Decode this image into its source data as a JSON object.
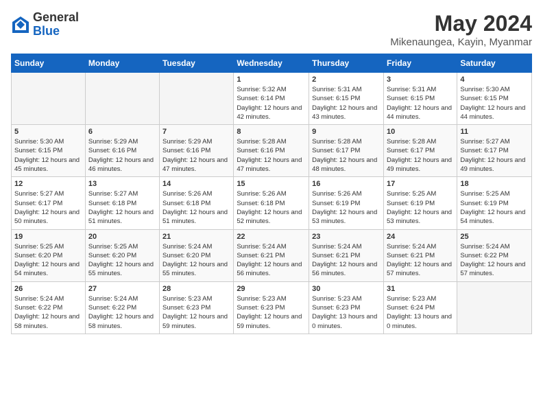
{
  "logo": {
    "general": "General",
    "blue": "Blue"
  },
  "title": "May 2024",
  "location": "Mikenaungea, Kayin, Myanmar",
  "days_of_week": [
    "Sunday",
    "Monday",
    "Tuesday",
    "Wednesday",
    "Thursday",
    "Friday",
    "Saturday"
  ],
  "weeks": [
    [
      {
        "day": "",
        "info": ""
      },
      {
        "day": "",
        "info": ""
      },
      {
        "day": "",
        "info": ""
      },
      {
        "day": "1",
        "info": "Sunrise: 5:32 AM\nSunset: 6:14 PM\nDaylight: 12 hours\nand 42 minutes."
      },
      {
        "day": "2",
        "info": "Sunrise: 5:31 AM\nSunset: 6:15 PM\nDaylight: 12 hours\nand 43 minutes."
      },
      {
        "day": "3",
        "info": "Sunrise: 5:31 AM\nSunset: 6:15 PM\nDaylight: 12 hours\nand 44 minutes."
      },
      {
        "day": "4",
        "info": "Sunrise: 5:30 AM\nSunset: 6:15 PM\nDaylight: 12 hours\nand 44 minutes."
      }
    ],
    [
      {
        "day": "5",
        "info": "Sunrise: 5:30 AM\nSunset: 6:15 PM\nDaylight: 12 hours\nand 45 minutes."
      },
      {
        "day": "6",
        "info": "Sunrise: 5:29 AM\nSunset: 6:16 PM\nDaylight: 12 hours\nand 46 minutes."
      },
      {
        "day": "7",
        "info": "Sunrise: 5:29 AM\nSunset: 6:16 PM\nDaylight: 12 hours\nand 47 minutes."
      },
      {
        "day": "8",
        "info": "Sunrise: 5:28 AM\nSunset: 6:16 PM\nDaylight: 12 hours\nand 47 minutes."
      },
      {
        "day": "9",
        "info": "Sunrise: 5:28 AM\nSunset: 6:17 PM\nDaylight: 12 hours\nand 48 minutes."
      },
      {
        "day": "10",
        "info": "Sunrise: 5:28 AM\nSunset: 6:17 PM\nDaylight: 12 hours\nand 49 minutes."
      },
      {
        "day": "11",
        "info": "Sunrise: 5:27 AM\nSunset: 6:17 PM\nDaylight: 12 hours\nand 49 minutes."
      }
    ],
    [
      {
        "day": "12",
        "info": "Sunrise: 5:27 AM\nSunset: 6:17 PM\nDaylight: 12 hours\nand 50 minutes."
      },
      {
        "day": "13",
        "info": "Sunrise: 5:27 AM\nSunset: 6:18 PM\nDaylight: 12 hours\nand 51 minutes."
      },
      {
        "day": "14",
        "info": "Sunrise: 5:26 AM\nSunset: 6:18 PM\nDaylight: 12 hours\nand 51 minutes."
      },
      {
        "day": "15",
        "info": "Sunrise: 5:26 AM\nSunset: 6:18 PM\nDaylight: 12 hours\nand 52 minutes."
      },
      {
        "day": "16",
        "info": "Sunrise: 5:26 AM\nSunset: 6:19 PM\nDaylight: 12 hours\nand 53 minutes."
      },
      {
        "day": "17",
        "info": "Sunrise: 5:25 AM\nSunset: 6:19 PM\nDaylight: 12 hours\nand 53 minutes."
      },
      {
        "day": "18",
        "info": "Sunrise: 5:25 AM\nSunset: 6:19 PM\nDaylight: 12 hours\nand 54 minutes."
      }
    ],
    [
      {
        "day": "19",
        "info": "Sunrise: 5:25 AM\nSunset: 6:20 PM\nDaylight: 12 hours\nand 54 minutes."
      },
      {
        "day": "20",
        "info": "Sunrise: 5:25 AM\nSunset: 6:20 PM\nDaylight: 12 hours\nand 55 minutes."
      },
      {
        "day": "21",
        "info": "Sunrise: 5:24 AM\nSunset: 6:20 PM\nDaylight: 12 hours\nand 55 minutes."
      },
      {
        "day": "22",
        "info": "Sunrise: 5:24 AM\nSunset: 6:21 PM\nDaylight: 12 hours\nand 56 minutes."
      },
      {
        "day": "23",
        "info": "Sunrise: 5:24 AM\nSunset: 6:21 PM\nDaylight: 12 hours\nand 56 minutes."
      },
      {
        "day": "24",
        "info": "Sunrise: 5:24 AM\nSunset: 6:21 PM\nDaylight: 12 hours\nand 57 minutes."
      },
      {
        "day": "25",
        "info": "Sunrise: 5:24 AM\nSunset: 6:22 PM\nDaylight: 12 hours\nand 57 minutes."
      }
    ],
    [
      {
        "day": "26",
        "info": "Sunrise: 5:24 AM\nSunset: 6:22 PM\nDaylight: 12 hours\nand 58 minutes."
      },
      {
        "day": "27",
        "info": "Sunrise: 5:24 AM\nSunset: 6:22 PM\nDaylight: 12 hours\nand 58 minutes."
      },
      {
        "day": "28",
        "info": "Sunrise: 5:23 AM\nSunset: 6:23 PM\nDaylight: 12 hours\nand 59 minutes."
      },
      {
        "day": "29",
        "info": "Sunrise: 5:23 AM\nSunset: 6:23 PM\nDaylight: 12 hours\nand 59 minutes."
      },
      {
        "day": "30",
        "info": "Sunrise: 5:23 AM\nSunset: 6:23 PM\nDaylight: 13 hours\nand 0 minutes."
      },
      {
        "day": "31",
        "info": "Sunrise: 5:23 AM\nSunset: 6:24 PM\nDaylight: 13 hours\nand 0 minutes."
      },
      {
        "day": "",
        "info": ""
      }
    ]
  ]
}
